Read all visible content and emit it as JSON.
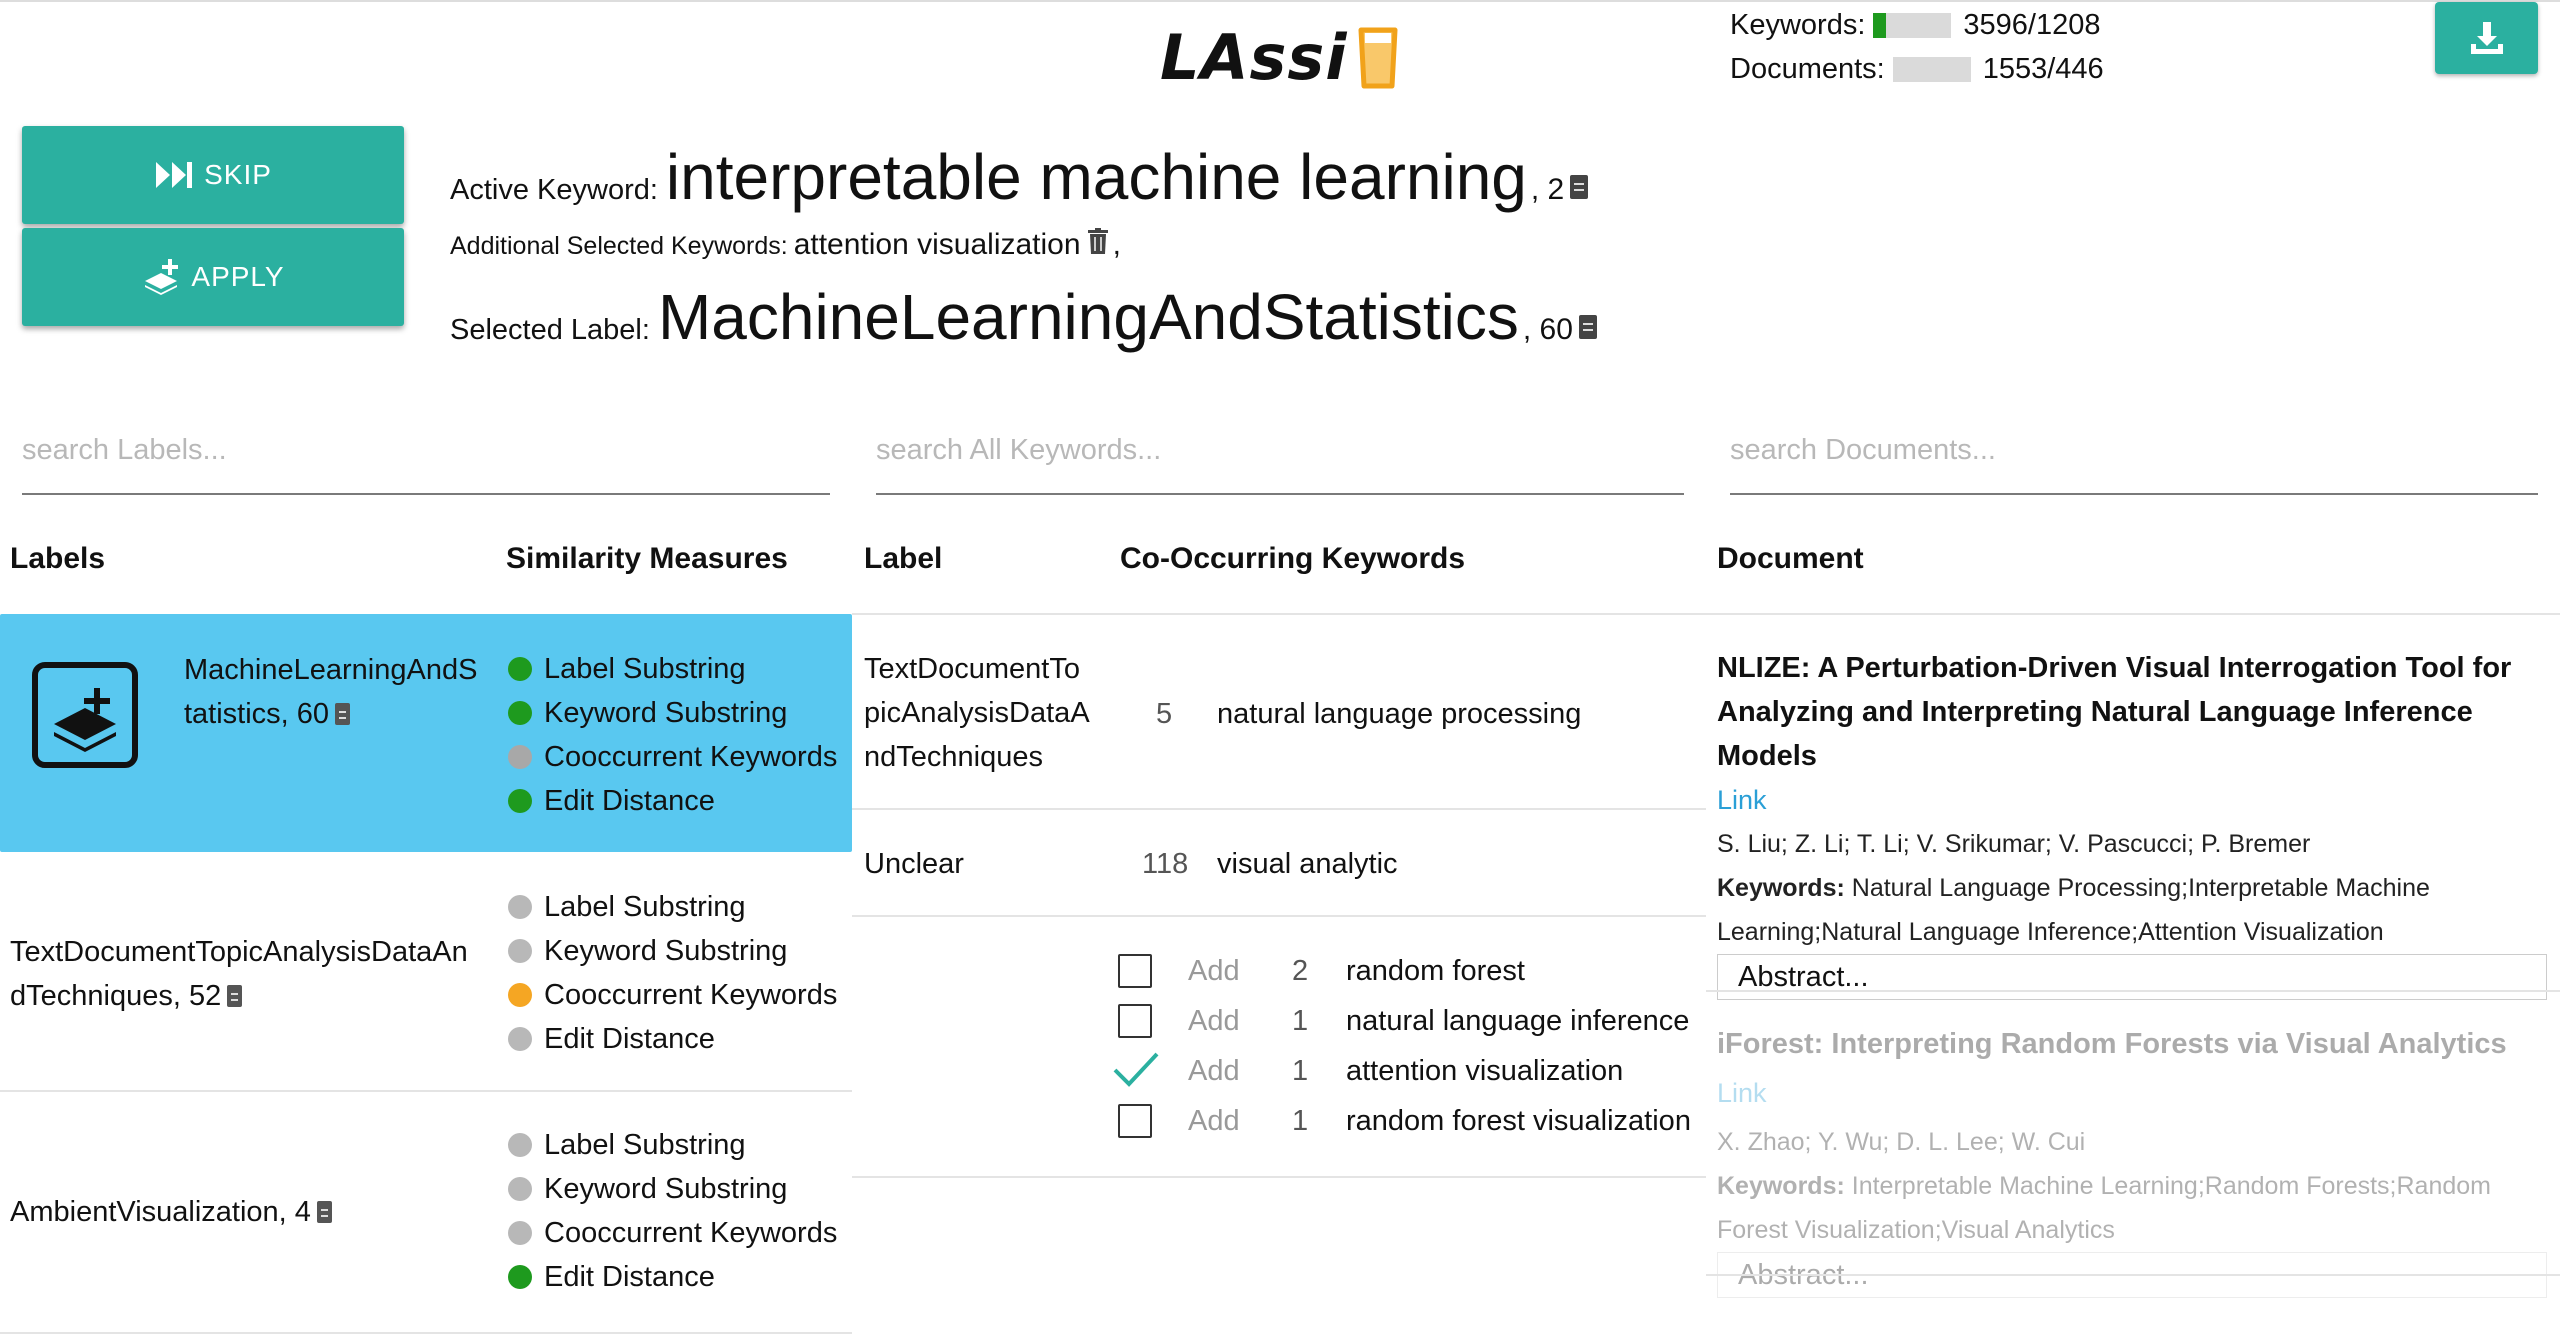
{
  "app": {
    "title": "LAssi"
  },
  "progress": {
    "keywords": {
      "label": "Keywords:",
      "value": "3596/1208",
      "fraction": 0.16
    },
    "documents": {
      "label": "Documents:",
      "value": "1553/446",
      "fraction": 0.0
    }
  },
  "actions": {
    "skip": "SKIP",
    "apply": "APPLY"
  },
  "active": {
    "keyword_label": "Active Keyword:",
    "keyword": "interpretable machine learning",
    "keyword_count": ", 2",
    "additional_label": "Additional Selected Keywords:",
    "additional": "attention visualization",
    "additional_sep": ",",
    "selected_label_label": "Selected Label:",
    "selected_label": "MachineLearningAndStatistics",
    "selected_label_count": ", 60"
  },
  "search": {
    "labels": "search Labels...",
    "keywords": "search All Keywords...",
    "documents": "search Documents..."
  },
  "headers": {
    "labels": "Labels",
    "similarity": "Similarity Measures",
    "label": "Label",
    "cooccurring": "Co-Occurring Keywords",
    "document": "Document"
  },
  "labels": [
    {
      "name_line1": "MachineLearningAndS",
      "name_line2": "tatistics, 60",
      "measures": [
        {
          "name": "Label Substring",
          "color": "#1e9a1e"
        },
        {
          "name": "Keyword Substring",
          "color": "#1e9a1e"
        },
        {
          "name": "Cooccurrent Keywords",
          "color": "#a8a8a8"
        },
        {
          "name": "Edit Distance",
          "color": "#1e9a1e"
        }
      ]
    },
    {
      "name_line1": "TextDocumentTopicAnalysisDataAn",
      "name_line2": "dTechniques, 52",
      "measures": [
        {
          "name": "Label Substring",
          "color": "#b8b8b8"
        },
        {
          "name": "Keyword Substring",
          "color": "#b8b8b8"
        },
        {
          "name": "Cooccurrent Keywords",
          "color": "#f5a623"
        },
        {
          "name": "Edit Distance",
          "color": "#b8b8b8"
        }
      ]
    },
    {
      "name_line1": "AmbientVisualization, 4",
      "name_line2": "",
      "measures": [
        {
          "name": "Label Substring",
          "color": "#b8b8b8"
        },
        {
          "name": "Keyword Substring",
          "color": "#b8b8b8"
        },
        {
          "name": "Cooccurrent Keywords",
          "color": "#b8b8b8"
        },
        {
          "name": "Edit Distance",
          "color": "#1e9a1e"
        }
      ]
    }
  ],
  "label_keyword_rows": [
    {
      "label_l1": "TextDocumentTo",
      "label_l2": "picAnalysisDataA",
      "label_l3": "ndTechniques",
      "count": "5",
      "keyword": "natural language processing"
    },
    {
      "label_l1": "Unclear",
      "count": "118",
      "keyword": "visual analytic"
    }
  ],
  "cooccurring": [
    {
      "checked": false,
      "add": "Add",
      "count": "2",
      "keyword": "random forest"
    },
    {
      "checked": false,
      "add": "Add",
      "count": "1",
      "keyword": "natural language inference"
    },
    {
      "checked": true,
      "add": "Add",
      "count": "1",
      "keyword": "attention visualization"
    },
    {
      "checked": false,
      "add": "Add",
      "count": "1",
      "keyword": "random forest visualization"
    }
  ],
  "documents": [
    {
      "title_l1": "NLIZE: A Perturbation-Driven Visual Interrogation Tool for",
      "title_l2": "Analyzing and Interpreting Natural Language Inference Models",
      "link": "Link",
      "authors": "S. Liu; Z. Li; T. Li; V. Srikumar; V. Pascucci; P. Bremer",
      "kw_label": "Keywords:",
      "kw_l1": "Natural Language Processing;Interpretable Machine",
      "kw_l2": "Learning;Natural Language Inference;Attention Visualization",
      "abstract": "Abstract..."
    },
    {
      "title_l1": "iForest: Interpreting Random Forests via Visual Analytics",
      "link": "Link",
      "authors": "X. Zhao; Y. Wu; D. L. Lee; W. Cui",
      "kw_label": "Keywords:",
      "kw_l1": "Interpretable Machine Learning;Random Forests;Random",
      "kw_l2": "Forest Visualization;Visual Analytics",
      "abstract": "Abstract..."
    }
  ]
}
